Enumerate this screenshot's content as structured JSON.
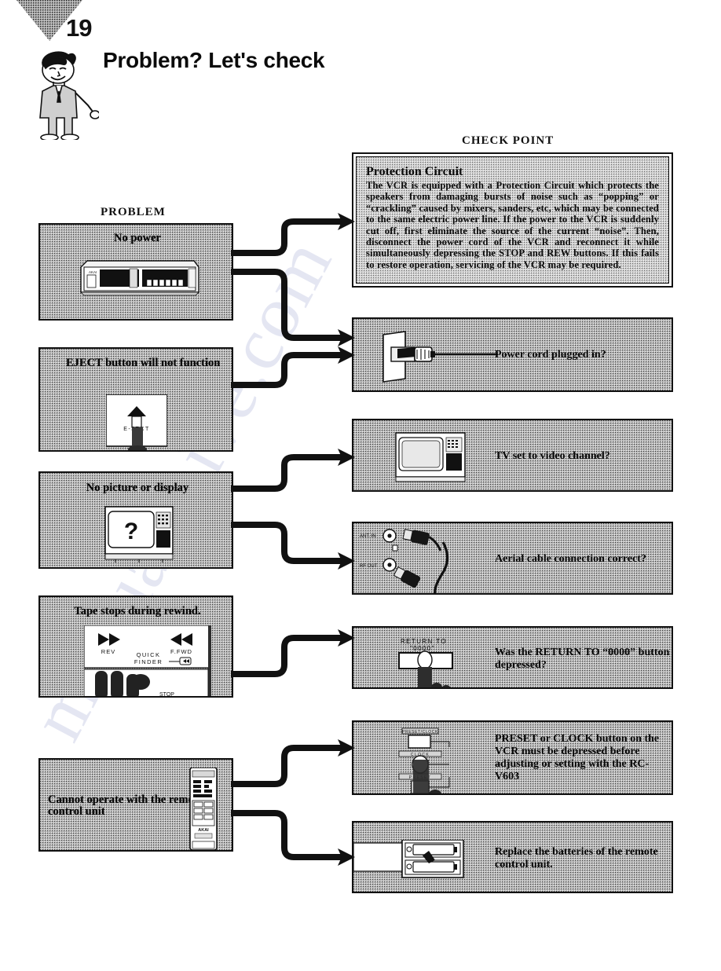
{
  "page": {
    "number": "19",
    "title": "Problem?  Let's check",
    "watermark": "manualshive.com"
  },
  "columns": {
    "problem_heading": "PROBLEM",
    "checkpoint_heading": "CHECK POINT"
  },
  "problems": [
    {
      "id": "no-power",
      "label": "No power",
      "illustration": "vcr-front-panel",
      "illustration_text": {
        "brand": "AKAI"
      }
    },
    {
      "id": "eject-button",
      "label": "EJECT button will not function",
      "illustration": "eject-button-finger",
      "illustration_text": {
        "button": "E-JECT"
      }
    },
    {
      "id": "no-picture",
      "label": "No picture or display",
      "illustration": "tv-question-mark",
      "illustration_text": {
        "screen": "?"
      }
    },
    {
      "id": "tape-stops",
      "label": "Tape stops during rewind.",
      "illustration": "quick-finder-panel",
      "illustration_text": {
        "left_button": "REV",
        "right_button": "F.FWD",
        "caption_line1": "QUICK",
        "caption_line2": "FINDER"
      }
    },
    {
      "id": "remote-fails",
      "label": "Cannot operate with the remote control unit",
      "illustration": "remote-control-unit",
      "illustration_text": {
        "brand": "AKAI"
      }
    }
  ],
  "checkpoints": [
    {
      "id": "protection-circuit",
      "kind": "text",
      "title": "Protection Circuit",
      "body": "The VCR is equipped with a Protection Circuit which protects the speakers from damaging bursts of noise such as “popping” or “crackling” caused by mixers, sanders, etc, which may be connected to the same electric power line. If the power to the VCR is suddenly cut off, first eliminate the source of the current “noise”. Then, disconnect the power cord of the VCR and reconnect it while simultaneously depressing the STOP and REW buttons. If this fails to restore operation, servicing of the VCR may be required."
    },
    {
      "id": "power-cord",
      "kind": "illustrated",
      "text": "Power cord plugged in?",
      "illustration": "wall-socket-plug"
    },
    {
      "id": "tv-video-channel",
      "kind": "illustrated",
      "text": "TV set to video channel?",
      "illustration": "television-set"
    },
    {
      "id": "aerial-cable",
      "kind": "illustrated",
      "text": "Aerial cable connection correct?",
      "illustration": "antenna-sockets-cable",
      "illustration_text": {
        "socket_top": "ANT. IN",
        "socket_bottom": "RF OUT"
      }
    },
    {
      "id": "return-to-0000",
      "kind": "illustrated",
      "text": "Was the RETURN TO “0000” button depressed?",
      "illustration": "return-to-0000-button",
      "illustration_text": {
        "label_line1": "RETURN TO",
        "label_line2": "“0000”"
      }
    },
    {
      "id": "preset-clock",
      "kind": "illustrated",
      "text": "PRESET or CLOCK button on the VCR must be depressed before adjusting or setting with the RC-V603",
      "illustration": "preset-clock-buttons",
      "illustration_text": {
        "button_top": "PRESET/CLOCK",
        "button_mid": "CLOCK",
        "button_bottom": "PRESET"
      }
    },
    {
      "id": "replace-batteries",
      "kind": "illustrated",
      "text": "Replace the batteries of the remote control unit.",
      "illustration": "battery-compartment"
    }
  ],
  "connectors": [
    {
      "id": "no-power-to-protection"
    },
    {
      "id": "no-power-to-power-cord"
    },
    {
      "id": "eject-to-power-cord"
    },
    {
      "id": "no-picture-to-tv-channel"
    },
    {
      "id": "no-picture-to-aerial"
    },
    {
      "id": "tape-stops-to-return"
    },
    {
      "id": "remote-to-preset-clock"
    },
    {
      "id": "remote-to-batteries"
    }
  ],
  "colors": {
    "ink": "#111111",
    "box_fill_gray": "#b9b9b9",
    "paper": "#ffffff"
  }
}
